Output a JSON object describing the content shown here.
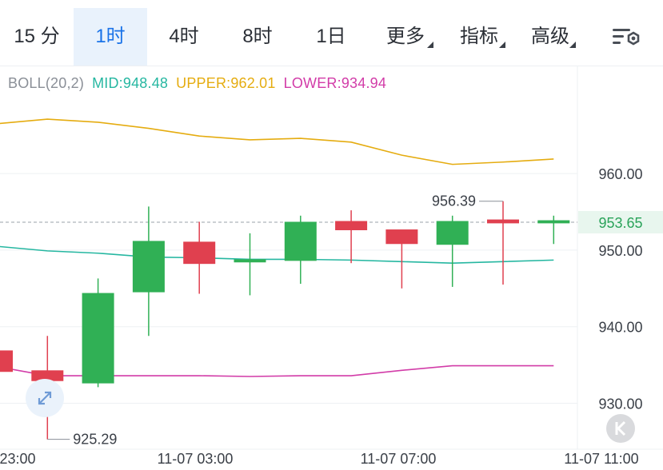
{
  "tabs": [
    {
      "label": "15 分",
      "active": false,
      "caret": false
    },
    {
      "label": "1时",
      "active": true,
      "caret": false
    },
    {
      "label": "4时",
      "active": false,
      "caret": false
    },
    {
      "label": "8时",
      "active": false,
      "caret": false
    },
    {
      "label": "1日",
      "active": false,
      "caret": false
    },
    {
      "label": "更多",
      "active": false,
      "caret": true
    },
    {
      "label": "指标",
      "active": false,
      "caret": true
    },
    {
      "label": "高级",
      "active": false,
      "caret": true
    }
  ],
  "indicator": {
    "name": "BOLL(20,2)",
    "mid_label": "MID:948.48",
    "upper_label": "UPPER:962.01",
    "lower_label": "LOWER:934.94",
    "colors": {
      "name": "#8a8f97",
      "mid": "#26b7a1",
      "upper": "#e5ac10",
      "lower": "#d23ca8"
    }
  },
  "icons": {
    "settings": "chart-settings-icon",
    "expand": "expand-arrows-icon",
    "k": "k-logo-icon"
  },
  "chart_data": {
    "type": "candlestick",
    "ylim": [
      924,
      974
    ],
    "y_ticks": [
      930,
      940,
      950,
      960
    ],
    "y_tick_labels": [
      "930.00",
      "940.00",
      "950.00",
      "960.00"
    ],
    "x_labels": [
      "23:00",
      "11-07 03:00",
      "11-07 07:00",
      "11-07 11:00"
    ],
    "current_price": 953.65,
    "current_price_label": "953.65",
    "max_label": "956.39",
    "min_label": "925.29",
    "candles": [
      {
        "open": 936.9,
        "close": 934.1,
        "high": 937.2,
        "low": 933.5
      },
      {
        "open": 934.3,
        "close": 932.9,
        "high": 938.8,
        "low": 925.29
      },
      {
        "open": 932.6,
        "close": 944.4,
        "high": 946.3,
        "low": 932.1
      },
      {
        "open": 944.5,
        "close": 951.2,
        "high": 955.7,
        "low": 938.8
      },
      {
        "open": 951.1,
        "close": 948.2,
        "high": 953.7,
        "low": 944.3
      },
      {
        "open": 948.4,
        "close": 948.8,
        "high": 952.2,
        "low": 944.1
      },
      {
        "open": 948.6,
        "close": 953.7,
        "high": 954.5,
        "low": 945.6
      },
      {
        "open": 953.8,
        "close": 952.6,
        "high": 955.2,
        "low": 948.3
      },
      {
        "open": 952.7,
        "close": 950.8,
        "high": 952.6,
        "low": 945.0
      },
      {
        "open": 950.7,
        "close": 953.8,
        "high": 954.5,
        "low": 945.2
      },
      {
        "open": 954.0,
        "close": 953.5,
        "high": 956.39,
        "low": 945.5
      },
      {
        "open": 953.5,
        "close": 953.9,
        "high": 954.5,
        "low": 950.8
      }
    ],
    "series": [
      {
        "name": "UPPER",
        "values": [
          966.5,
          967.1,
          966.7,
          965.9,
          964.9,
          964.4,
          964.6,
          964.1,
          962.4,
          961.2,
          961.5,
          961.9
        ]
      },
      {
        "name": "MID",
        "values": [
          950.5,
          949.9,
          949.6,
          949.1,
          949.0,
          948.8,
          948.8,
          948.7,
          948.5,
          948.3,
          948.5,
          948.7
        ]
      },
      {
        "name": "LOWER",
        "values": [
          934.8,
          933.6,
          933.6,
          933.6,
          933.6,
          933.5,
          933.6,
          933.6,
          934.3,
          934.9,
          934.9,
          934.9
        ]
      }
    ]
  }
}
